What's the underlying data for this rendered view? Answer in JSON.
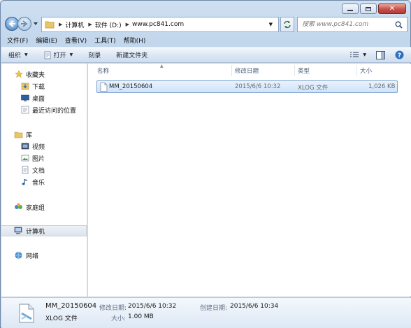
{
  "window": {
    "buttons": {
      "minimize": "minimize-icon",
      "maximize": "maximize-icon",
      "close": "close-icon"
    }
  },
  "address": {
    "crumbs": [
      "计算机",
      "软件 (D:)",
      "www.pc841.com"
    ]
  },
  "search": {
    "placeholder": "搜索 www.pc841.com"
  },
  "menu": [
    "文件(F)",
    "编辑(E)",
    "查看(V)",
    "工具(T)",
    "帮助(H)"
  ],
  "toolbar": {
    "organize": "组织",
    "open": "打开",
    "burn": "刻录",
    "new_folder": "新建文件夹"
  },
  "nav": {
    "favorites": "收藏夹",
    "downloads": "下载",
    "desktop": "桌面",
    "recent": "最近访问的位置",
    "libraries": "库",
    "videos": "视频",
    "pictures": "图片",
    "documents": "文档",
    "music": "音乐",
    "homegroup": "家庭组",
    "computer": "计算机",
    "network": "网络"
  },
  "columns": {
    "name": "名称",
    "modified": "修改日期",
    "type": "类型",
    "size": "大小"
  },
  "files": [
    {
      "name": "MM_20150604",
      "modified": "2015/6/6 10:32",
      "type": "XLOG 文件",
      "size": "1,026 KB"
    }
  ],
  "details": {
    "name": "MM_20150604",
    "type": "XLOG 文件",
    "modified_label": "修改日期:",
    "modified": "2015/6/6 10:32",
    "created_label": "创建日期:",
    "created": "2015/6/6 10:34",
    "size_label": "大小:",
    "size": "1.00 MB"
  }
}
